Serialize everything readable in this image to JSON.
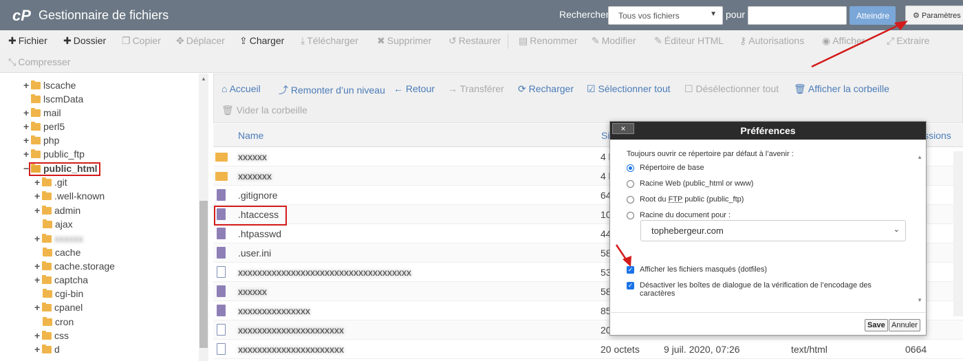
{
  "header": {
    "title": "Gestionnaire de fichiers",
    "search_label": "Rechercher",
    "search_scope": "Tous vos fichiers",
    "pour_label": "pour",
    "go_label": "Atteindre",
    "settings_label": "Paramètres"
  },
  "toolbar": {
    "items": [
      {
        "label": "Fichier",
        "icon": "plus-icon"
      },
      {
        "label": "Dossier",
        "icon": "plus-icon"
      },
      {
        "label": "Copier",
        "icon": "copy-icon"
      },
      {
        "label": "Déplacer",
        "icon": "move-icon"
      },
      {
        "label": "Charger",
        "icon": "upload-icon"
      },
      {
        "label": "Télécharger",
        "icon": "download-icon"
      },
      {
        "label": "Supprimer",
        "icon": "delete-icon"
      },
      {
        "label": "Restaurer",
        "icon": "restore-icon"
      },
      {
        "label": "Renommer",
        "icon": "rename-icon"
      },
      {
        "label": "Modifier",
        "icon": "edit-icon"
      },
      {
        "label": "Éditeur HTML",
        "icon": "html-editor-icon"
      },
      {
        "label": "Autorisations",
        "icon": "key-icon"
      },
      {
        "label": "Afficher",
        "icon": "eye-icon"
      },
      {
        "label": "Extraire",
        "icon": "extract-icon"
      },
      {
        "label": "Compresser",
        "icon": "compress-icon"
      }
    ]
  },
  "sidebar": {
    "items": [
      {
        "label": "lscache"
      },
      {
        "label": "lscmData"
      },
      {
        "label": "mail"
      },
      {
        "label": "perl5"
      },
      {
        "label": "php"
      },
      {
        "label": "public_ftp"
      },
      {
        "label": "public_html"
      },
      {
        "label": ".git"
      },
      {
        "label": ".well-known"
      },
      {
        "label": "admin"
      },
      {
        "label": "ajax"
      },
      {
        "label": "cache"
      },
      {
        "label": "cache.storage"
      },
      {
        "label": "captcha"
      },
      {
        "label": "cgi-bin"
      },
      {
        "label": "cpanel"
      },
      {
        "label": "cron"
      },
      {
        "label": "css"
      },
      {
        "label": "d"
      }
    ]
  },
  "nav": {
    "home": "Accueil",
    "up": "Remonter d’un niveau",
    "back": "Retour",
    "forward": "Transférer",
    "reload": "Recharger",
    "select_all": "Sélectionner tout",
    "deselect_all": "Désélectionner tout",
    "trash": "Afficher la corbeille",
    "empty_trash": "Vider la corbeille"
  },
  "table": {
    "col_name": "Name",
    "col_size": "Si",
    "col_perms": "issions",
    "rows": [
      {
        "name": "",
        "size": "4 k",
        "date": "",
        "type": "",
        "perms": ""
      },
      {
        "name": "",
        "size": "4 k",
        "date": "",
        "type": "",
        "perms": ""
      },
      {
        "name": ".gitignore",
        "size": "64",
        "date": "",
        "type": "",
        "perms": ""
      },
      {
        "name": ".htaccess",
        "size": "10",
        "date": "",
        "type": "",
        "perms": ""
      },
      {
        "name": ".htpasswd",
        "size": "44",
        "date": "",
        "type": "",
        "perms": ""
      },
      {
        "name": ".user.ini",
        "size": "58",
        "date": "",
        "type": "",
        "perms": ""
      },
      {
        "name": "",
        "size": "53",
        "date": "",
        "type": "",
        "perms": ""
      },
      {
        "name": "",
        "size": "58",
        "date": "",
        "type": "",
        "perms": ""
      },
      {
        "name": "",
        "size": "85",
        "date": "",
        "type": "",
        "perms": ""
      },
      {
        "name": "",
        "size": "20",
        "date": "",
        "type": "",
        "perms": ""
      },
      {
        "name": "",
        "size": "20 octets",
        "date": "9 juil. 2020, 07:26",
        "type": "text/html",
        "perms": "0664"
      }
    ]
  },
  "dialog": {
    "title": "Préférences",
    "close": "×",
    "intro": "Toujours ouvrir ce répertoire par défaut à l’avenir :",
    "opt_base": "Répertoire de base",
    "opt_web": "Racine Web (public_html or www)",
    "opt_ftp_pre": "Root du ",
    "opt_ftp_abbr": "FTP",
    "opt_ftp_post": " public (public_ftp)",
    "opt_docroot": "Racine du document pour :",
    "domain": "tophebergeur.com",
    "show_hidden": "Afficher les fichiers masqués (dotfiles)",
    "disable_enc_1": "Désactiver les boîtes de dialogue de la vérification de l’encodage des",
    "disable_enc_2": "caractères",
    "save": "Save",
    "cancel": "Annuler"
  },
  "colors": {
    "topbar": "#6b7784",
    "link": "#4a7bb7",
    "annotation": "#d31b1b",
    "checkbox": "#1a73e8"
  }
}
